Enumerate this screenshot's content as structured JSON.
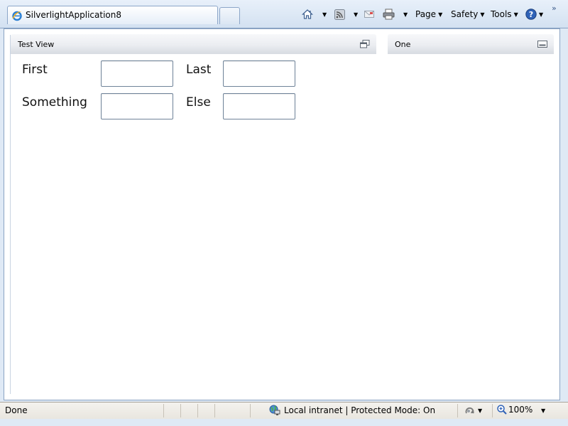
{
  "browser": {
    "tab_title": "SilverlightApplication8",
    "commands": {
      "page": "Page",
      "safety": "Safety",
      "tools": "Tools"
    },
    "chevron": "»"
  },
  "app": {
    "left_panel": {
      "title": "Test View"
    },
    "right_panel": {
      "title": "One"
    },
    "form": {
      "first_label": "First",
      "last_label": "Last",
      "something_label": "Something",
      "else_label": "Else",
      "first_value": "",
      "last_value": "",
      "something_value": "",
      "else_value": ""
    }
  },
  "status": {
    "text": "Done",
    "zone": "Local intranet | Protected Mode: On",
    "zoom": "100%"
  },
  "colors": {
    "chrome_bg": "#dfe9f5",
    "border": "#8aa3c3",
    "status_bg": "#ece9e2"
  }
}
